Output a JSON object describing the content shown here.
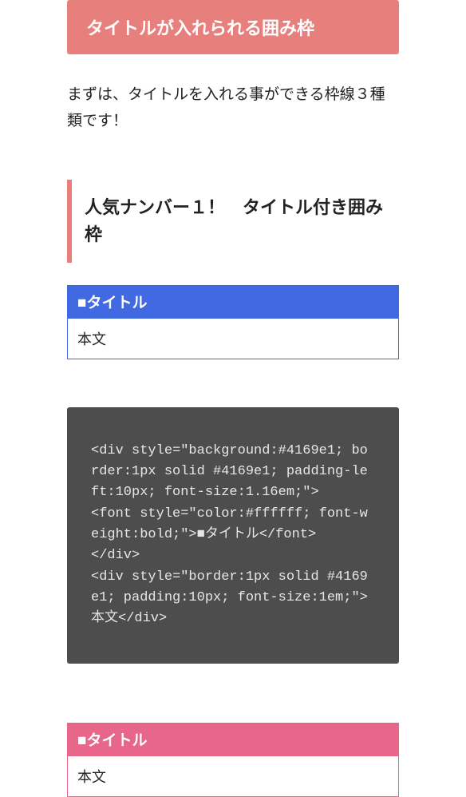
{
  "header": {
    "title": "タイトルが入れられる囲み枠"
  },
  "intro": "まずは、タイトルを入れる事ができる枠線３種類です！",
  "section_heading": "人気ナンバー１！　タイトル付き囲み枠",
  "box_blue": {
    "title": "■タイトル",
    "body": "本文"
  },
  "code_block": "<div style=\"background:#4169e1; border:1px solid #4169e1; padding-left:10px; font-size:1.16em;\">\n<font style=\"color:#ffffff; font-weight:bold;\">■タイトル</font>\n</div>\n<div style=\"border:1px solid #4169e1; padding:10px; font-size:1em;\">本文</div>",
  "box_pink": {
    "title": "■タイトル",
    "body": "本文"
  }
}
